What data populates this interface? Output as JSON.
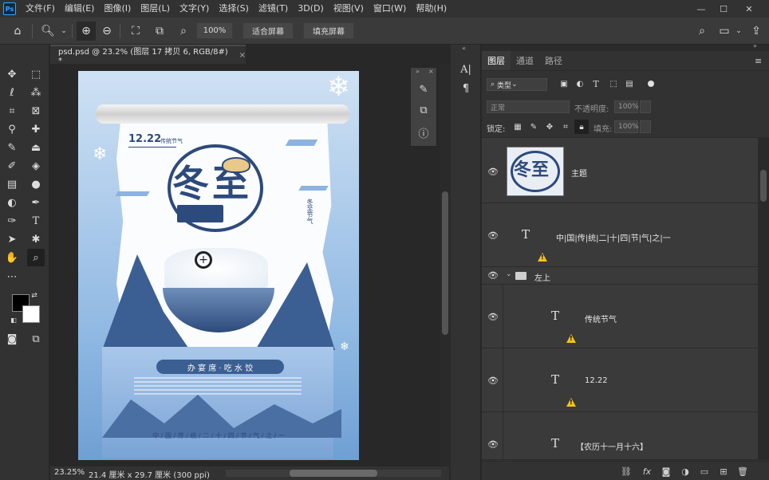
{
  "menubar": {
    "logo": "Ps",
    "items": [
      "文件(F)",
      "编辑(E)",
      "图像(I)",
      "图层(L)",
      "文字(Y)",
      "选择(S)",
      "滤镜(T)",
      "3D(D)",
      "视图(V)",
      "窗口(W)",
      "帮助(H)"
    ],
    "window_controls": [
      "—",
      "☐",
      "✕"
    ]
  },
  "options": {
    "zoom_value": "100%",
    "fit_screen": "适合屏幕",
    "fill_screen": "填充屏幕"
  },
  "document": {
    "tab_title": "psd.psd @ 23.2% (图层 17 拷贝 6, RGB/8#) *",
    "close": "×"
  },
  "poster": {
    "date": "12.22",
    "subtitle": "传统节气",
    "title_chars": "冬至",
    "small_label": "【农历十一月十六】",
    "ribbon": "办 宴 席 · 吃 水 饺",
    "footer": "中 / 国 / 传 / 统 / 二 / 十 / 四 / 节 / 气 / 之 / 一",
    "side_text": "冬至节气"
  },
  "status": {
    "zoom": "23.25%",
    "size": "21.4 厘米 x 29.7 厘米 (300 ppi)"
  },
  "layers_panel": {
    "tabs": [
      "图层",
      "通道",
      "路径"
    ],
    "filter_kind": "类型",
    "blend_mode": "正常",
    "opacity_label": "不透明度:",
    "opacity_value": "100%",
    "lock_label": "锁定:",
    "fill_label": "填充:",
    "fill_value": "100%",
    "layers": [
      {
        "name": "主题",
        "type": "image"
      },
      {
        "name": "中|国|传|统|二|十|四|节|气|之|一",
        "type": "text",
        "warn": true
      },
      {
        "name": "左上",
        "type": "group"
      },
      {
        "name": "传统节气",
        "type": "text",
        "warn": true
      },
      {
        "name": "12.22",
        "type": "text",
        "warn": true
      },
      {
        "name": "【农历十一月十六】",
        "type": "text"
      }
    ]
  },
  "colors": {
    "accent": "#31a8ff",
    "warning": "#f4c21a",
    "poster_blue": "#2d4a7c"
  }
}
